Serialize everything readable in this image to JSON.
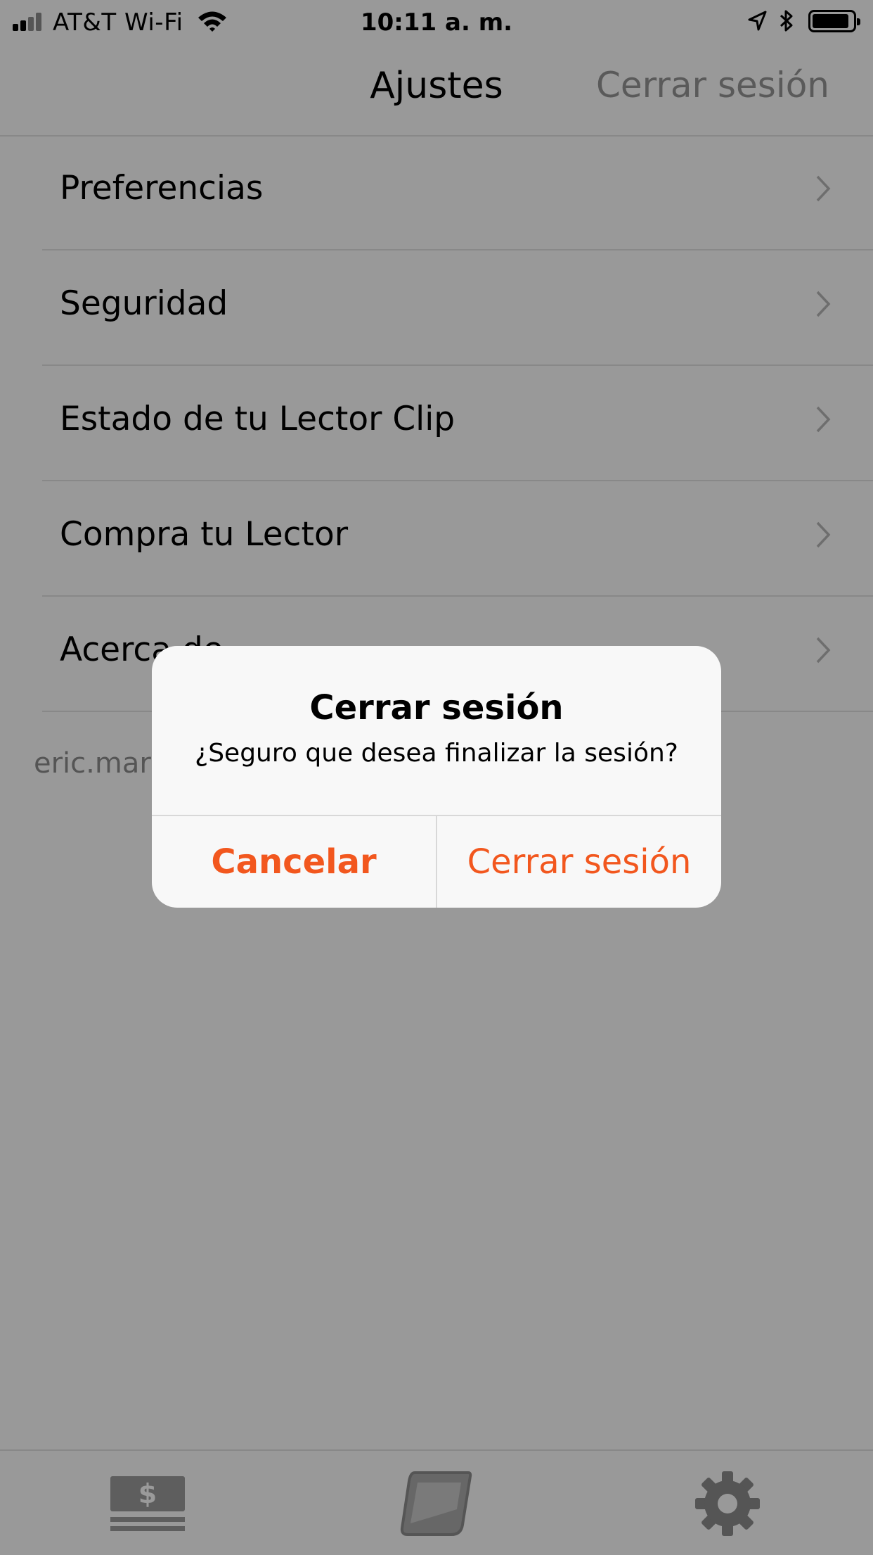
{
  "status_bar": {
    "carrier": "AT&T Wi-Fi",
    "time": "10:11 a. m.",
    "icons": [
      "signal-icon",
      "wifi-icon",
      "location-arrow-icon",
      "bluetooth-icon",
      "battery-icon"
    ]
  },
  "nav": {
    "title": "Ajustes",
    "right_action": "Cerrar sesión"
  },
  "menu": {
    "items": [
      {
        "label": "Preferencias"
      },
      {
        "label": "Seguridad"
      },
      {
        "label": "Estado de tu Lector Clip"
      },
      {
        "label": "Compra tu Lector"
      },
      {
        "label": "Acerca de"
      }
    ]
  },
  "account": {
    "email": "eric.mar"
  },
  "tabbar": {
    "tabs": [
      {
        "icon": "cash-register-icon"
      },
      {
        "icon": "card-reader-icon"
      },
      {
        "icon": "gear-icon",
        "selected": true
      }
    ]
  },
  "alert": {
    "title": "Cerrar sesión",
    "message": "¿Seguro que desea finalizar la sesión?",
    "cancel_label": "Cancelar",
    "confirm_label": "Cerrar sesión"
  },
  "colors": {
    "accent": "#f2571e",
    "dim_background": "#999999",
    "alert_background": "#f8f8f8"
  }
}
